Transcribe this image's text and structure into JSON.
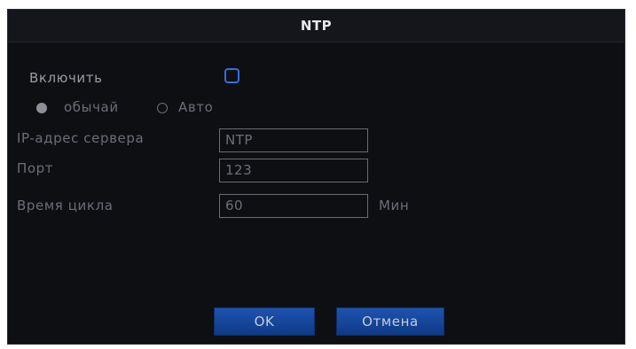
{
  "window": {
    "title": "NTP"
  },
  "enable": {
    "label": "Включить",
    "checked": false
  },
  "mode": {
    "options": [
      {
        "label": "обычай",
        "selected": true
      },
      {
        "label": "Авто",
        "selected": false
      }
    ]
  },
  "fields": {
    "server": {
      "label": "IP-адрес сервера",
      "value": "NTP"
    },
    "port": {
      "label": "Порт",
      "value": "123"
    },
    "cycle": {
      "label": "Время цикла",
      "value": "60",
      "unit": "Мин"
    }
  },
  "buttons": {
    "ok": "OK",
    "cancel": "Отмена"
  },
  "colors": {
    "accent": "#2e6fe0",
    "button": "#1f53b0",
    "background": "#0e0f12"
  }
}
